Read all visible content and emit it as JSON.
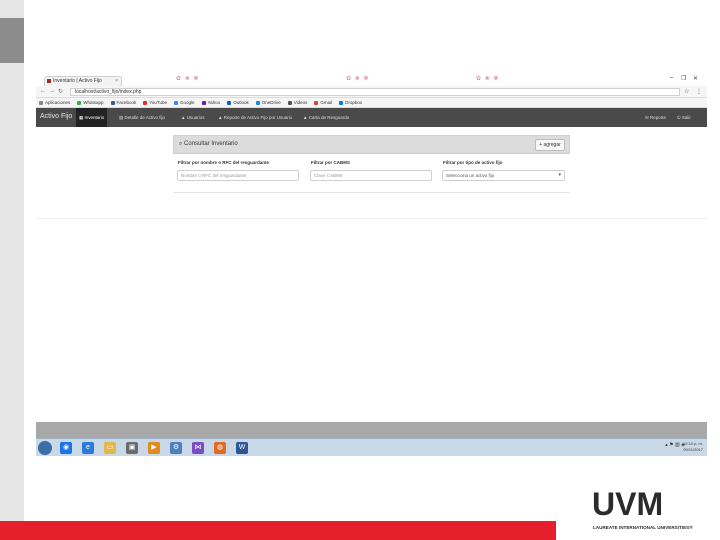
{
  "browser": {
    "tab_title": "Inventario | Activo Fijo",
    "url": "localhost/activo_fijo/index.php",
    "bookmarks": [
      {
        "label": "Aplicaciones",
        "color": "#888888"
      },
      {
        "label": "Whatsapp",
        "color": "#2fb44a"
      },
      {
        "label": "Facebook",
        "color": "#3b5998"
      },
      {
        "label": "YouTube",
        "color": "#e52d27"
      },
      {
        "label": "Google",
        "color": "#4285f4"
      },
      {
        "label": "Yahoo",
        "color": "#6b1f9c"
      },
      {
        "label": "Outlook",
        "color": "#0a64c8"
      },
      {
        "label": "OneDrive",
        "color": "#1e88e5"
      },
      {
        "label": "Videos",
        "color": "#555555"
      },
      {
        "label": "Gmail",
        "color": "#d44638"
      },
      {
        "label": "Dropbox",
        "color": "#007ee5"
      }
    ]
  },
  "app": {
    "brand": "Activo Fijo",
    "nav": [
      {
        "label": "Inventario"
      },
      {
        "label": "Detalle de Activo fijo"
      },
      {
        "label": "Usuarios"
      },
      {
        "label": "Reporte de Activo Fijo por Usuario"
      },
      {
        "label": "Carta de Resguardo"
      }
    ],
    "nav_right": [
      {
        "label": "Reporte"
      },
      {
        "label": "Salir"
      }
    ]
  },
  "panel": {
    "title": "Consultar Inventario",
    "add_label": "+ agregar",
    "filters": [
      {
        "label": "Filtrar por nombre o RFC del resguardante",
        "placeholder": "Nombre o RFC del resguardante"
      },
      {
        "label": "Filtrar por CABMS",
        "placeholder": "Clave CABMS"
      },
      {
        "label": "Filtrar por tipo de activo fijo",
        "value": "Selecciona un activo fijo"
      }
    ]
  },
  "taskbar": {
    "clock_time": "12:10 p. m.",
    "clock_date": "09/11/2017"
  },
  "logo": {
    "name": "UVM",
    "tagline": "LAUREATE INTERNATIONAL UNIVERSITIES®"
  },
  "colors": {
    "accent_red": "#e5202c",
    "nav_bg": "#4a4a4a"
  }
}
